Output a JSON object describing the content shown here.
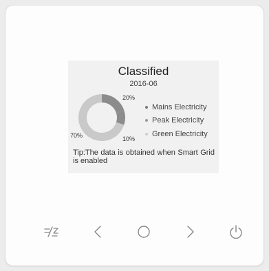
{
  "screen": {
    "title": "Classified",
    "date": "2016-06",
    "tip": "Tip:The data is obtained when Smart Grid is enabled"
  },
  "chart_data": {
    "type": "pie",
    "donut": true,
    "categories": [
      "Mains Electricity",
      "Peak Electricity",
      "Green Electricity"
    ],
    "values": [
      20,
      10,
      70
    ],
    "labels": [
      "20%",
      "10%",
      "70%"
    ],
    "colors": [
      "#8c8c8c",
      "#8c8c8c",
      "#c9c9c9"
    ],
    "legend_colors": [
      "#777777",
      "#999999",
      "#cfcfcf"
    ]
  },
  "controls": {
    "icons": [
      "mode-icon",
      "chevron-left-icon",
      "circle-icon",
      "chevron-right-icon",
      "power-icon"
    ],
    "color": "#888888"
  },
  "colors": {
    "panel": "#fdfdfd",
    "screen": "#f1f1f1",
    "text": "#333333"
  }
}
